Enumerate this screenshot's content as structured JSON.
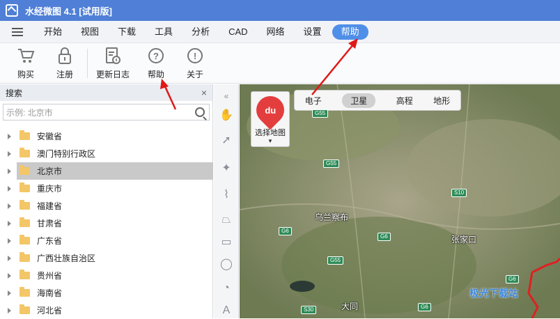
{
  "window": {
    "title": "水经微图 4.1 [试用版]"
  },
  "menu": {
    "items": [
      "开始",
      "视图",
      "下载",
      "工具",
      "分析",
      "CAD",
      "网络",
      "设置",
      "帮助"
    ],
    "active": "帮助"
  },
  "toolbar": {
    "buy": "购买",
    "register": "注册",
    "changelog": "更新日志",
    "help": "帮助",
    "about": "关于"
  },
  "search_panel": {
    "title": "搜索",
    "placeholder": "示例: 北京市",
    "provinces": [
      "安徽省",
      "澳门特别行政区",
      "北京市",
      "重庆市",
      "福建省",
      "甘肃省",
      "广东省",
      "广西壮族自治区",
      "贵州省",
      "海南省",
      "河北省"
    ],
    "selected": "北京市"
  },
  "map": {
    "selector_label": "选择地图",
    "selector_logo": "du",
    "types": [
      "电子",
      "卫星",
      "高程",
      "地形"
    ],
    "active_type": "卫星",
    "cities": [
      "乌兰察布",
      "张家口",
      "大同"
    ],
    "roads": [
      "G55",
      "G55",
      "S10",
      "G6",
      "G6",
      "G55",
      "G6",
      "S30",
      "G6"
    ]
  },
  "watermark": "极光下载站"
}
